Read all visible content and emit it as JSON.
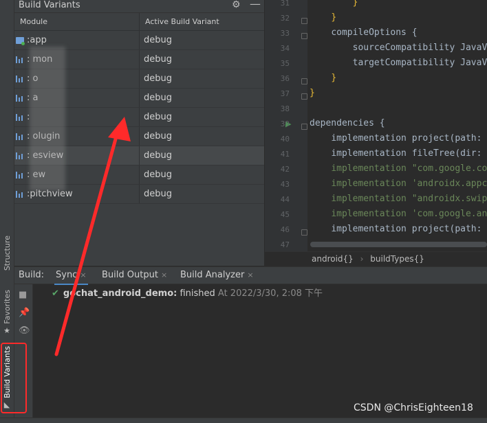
{
  "left_strip": {
    "structure_label": "Structure",
    "favorites_label": "Favorites",
    "build_variants_label": "Build Variants"
  },
  "build_variants": {
    "title": "Build Variants",
    "columns": [
      "Module",
      "Active Build Variant"
    ],
    "rows": [
      {
        "module": ":app",
        "variant": "debug"
      },
      {
        "module": ":    mon",
        "variant": "debug"
      },
      {
        "module": ":      o",
        "variant": "debug"
      },
      {
        "module": ":    a",
        "variant": "debug"
      },
      {
        "module": ":",
        "variant": "debug"
      },
      {
        "module": ":    olugin",
        "variant": "debug"
      },
      {
        "module": ":    esview",
        "variant": "debug"
      },
      {
        "module": ":    ew",
        "variant": "debug"
      },
      {
        "module": ":pitchview",
        "variant": "debug"
      }
    ]
  },
  "editor": {
    "line_numbers": [
      "31",
      "32",
      "33",
      "34",
      "35",
      "36",
      "37",
      "38",
      "39",
      "40",
      "41",
      "42",
      "43",
      "44",
      "45",
      "46",
      "47"
    ],
    "lines": [
      {
        "indent": "        ",
        "text": "}",
        "cls": "br"
      },
      {
        "indent": "    ",
        "text": "}",
        "cls": "br"
      },
      {
        "indent": "    ",
        "text": "compileOptions {",
        "cls": "kw"
      },
      {
        "indent": "        ",
        "text": "sourceCompatibility JavaV",
        "cls": "kw"
      },
      {
        "indent": "        ",
        "text": "targetCompatibility JavaV",
        "cls": "kw"
      },
      {
        "indent": "    ",
        "text": "}",
        "cls": "br"
      },
      {
        "indent": "",
        "text": "}",
        "cls": "br"
      },
      {
        "indent": "",
        "text": "",
        "cls": "kw"
      },
      {
        "indent": "",
        "text": "dependencies {",
        "cls": "kw"
      },
      {
        "indent": "    ",
        "text": "implementation project(path:",
        "cls": "kw"
      },
      {
        "indent": "    ",
        "text": "implementation fileTree(dir:",
        "cls": "kw"
      },
      {
        "indent": "    ",
        "text": "implementation \"com.google.co",
        "cls": "str"
      },
      {
        "indent": "    ",
        "text": "implementation 'androidx.appc",
        "cls": "str"
      },
      {
        "indent": "    ",
        "text": "implementation \"androidx.swip",
        "cls": "str"
      },
      {
        "indent": "    ",
        "text": "implementation 'com.google.an",
        "cls": "str"
      },
      {
        "indent": "    ",
        "text": "implementation project(path:",
        "cls": "kw"
      },
      {
        "indent": "",
        "text": "",
        "cls": "kw"
      }
    ],
    "breadcrumb": [
      "android{}",
      "buildTypes{}"
    ]
  },
  "build": {
    "label": "Build:",
    "tabs": [
      {
        "label": "Sync"
      },
      {
        "label": "Build Output"
      },
      {
        "label": "Build Analyzer"
      }
    ],
    "result": {
      "project": "gochat_android_demo:",
      "status": " finished",
      "time": " At 2022/3/30, 2:08 下午"
    }
  },
  "watermark": "CSDN @ChrisEighteen18",
  "colors": {
    "accent": "#4a88c7",
    "annotation": "#ff2a2a",
    "success": "#59a869"
  }
}
